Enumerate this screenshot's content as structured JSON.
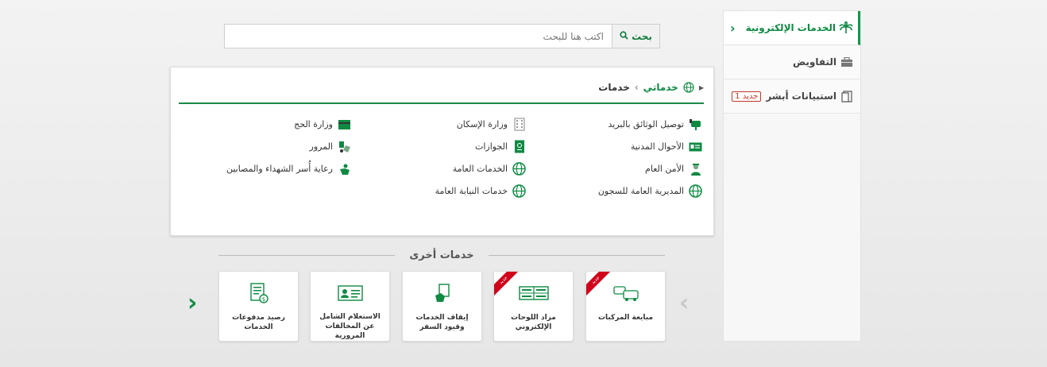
{
  "sidebar": {
    "header": "الخدمات الإلكترونية",
    "items": [
      {
        "label": "التفاويض",
        "badge": ""
      },
      {
        "label": "استبيانات أبشر",
        "badge": "جديد 1"
      }
    ]
  },
  "search": {
    "button": "بحث",
    "placeholder": "اكتب هنا للبحث"
  },
  "breadcrumb": {
    "mine": "خدماتي",
    "sep": "›",
    "current": "خدمات"
  },
  "services": {
    "col1": [
      "توصيل الوثائق بالبريد",
      "الأحوال المدنية",
      "الأمن العام",
      "المديرية العامة للسجون"
    ],
    "col2": [
      "وزارة الإسكان",
      "الجوازات",
      "الخدمات العامة",
      "خدمات النيابة العامة"
    ],
    "col3": [
      "وزارة الحج",
      "المرور",
      "رعاية أُسر الشهداء والمصابين"
    ]
  },
  "other": {
    "title": "خدمات أخرى",
    "cards": [
      {
        "label": "مبايعة المركبات",
        "ribbon": "جديد"
      },
      {
        "label": "مزاد اللوحات الإلكتروني",
        "ribbon": "جديد"
      },
      {
        "label": "إيقاف الخدمات وقيود السفر",
        "ribbon": ""
      },
      {
        "label": "الاستعلام الشامل عن المخالفات المرورية",
        "ribbon": ""
      },
      {
        "label": "رصيد مدفوعات الخدمات",
        "ribbon": ""
      }
    ]
  },
  "colors": {
    "brand": "#0e8a43",
    "ribbon": "#d0021b"
  }
}
